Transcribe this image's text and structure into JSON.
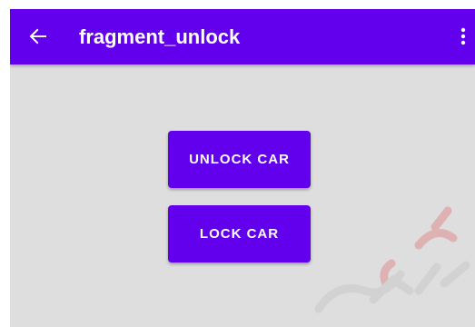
{
  "app_bar": {
    "title": "fragment_unlock",
    "back_icon": "arrow-back-icon",
    "menu_icon": "more-vert-icon"
  },
  "buttons": {
    "unlock_label": "UNLOCK CAR",
    "lock_label": "LOCK CAR"
  },
  "colors": {
    "primary": "#6200ee",
    "background": "#dedede",
    "on_primary": "#ffffff"
  }
}
